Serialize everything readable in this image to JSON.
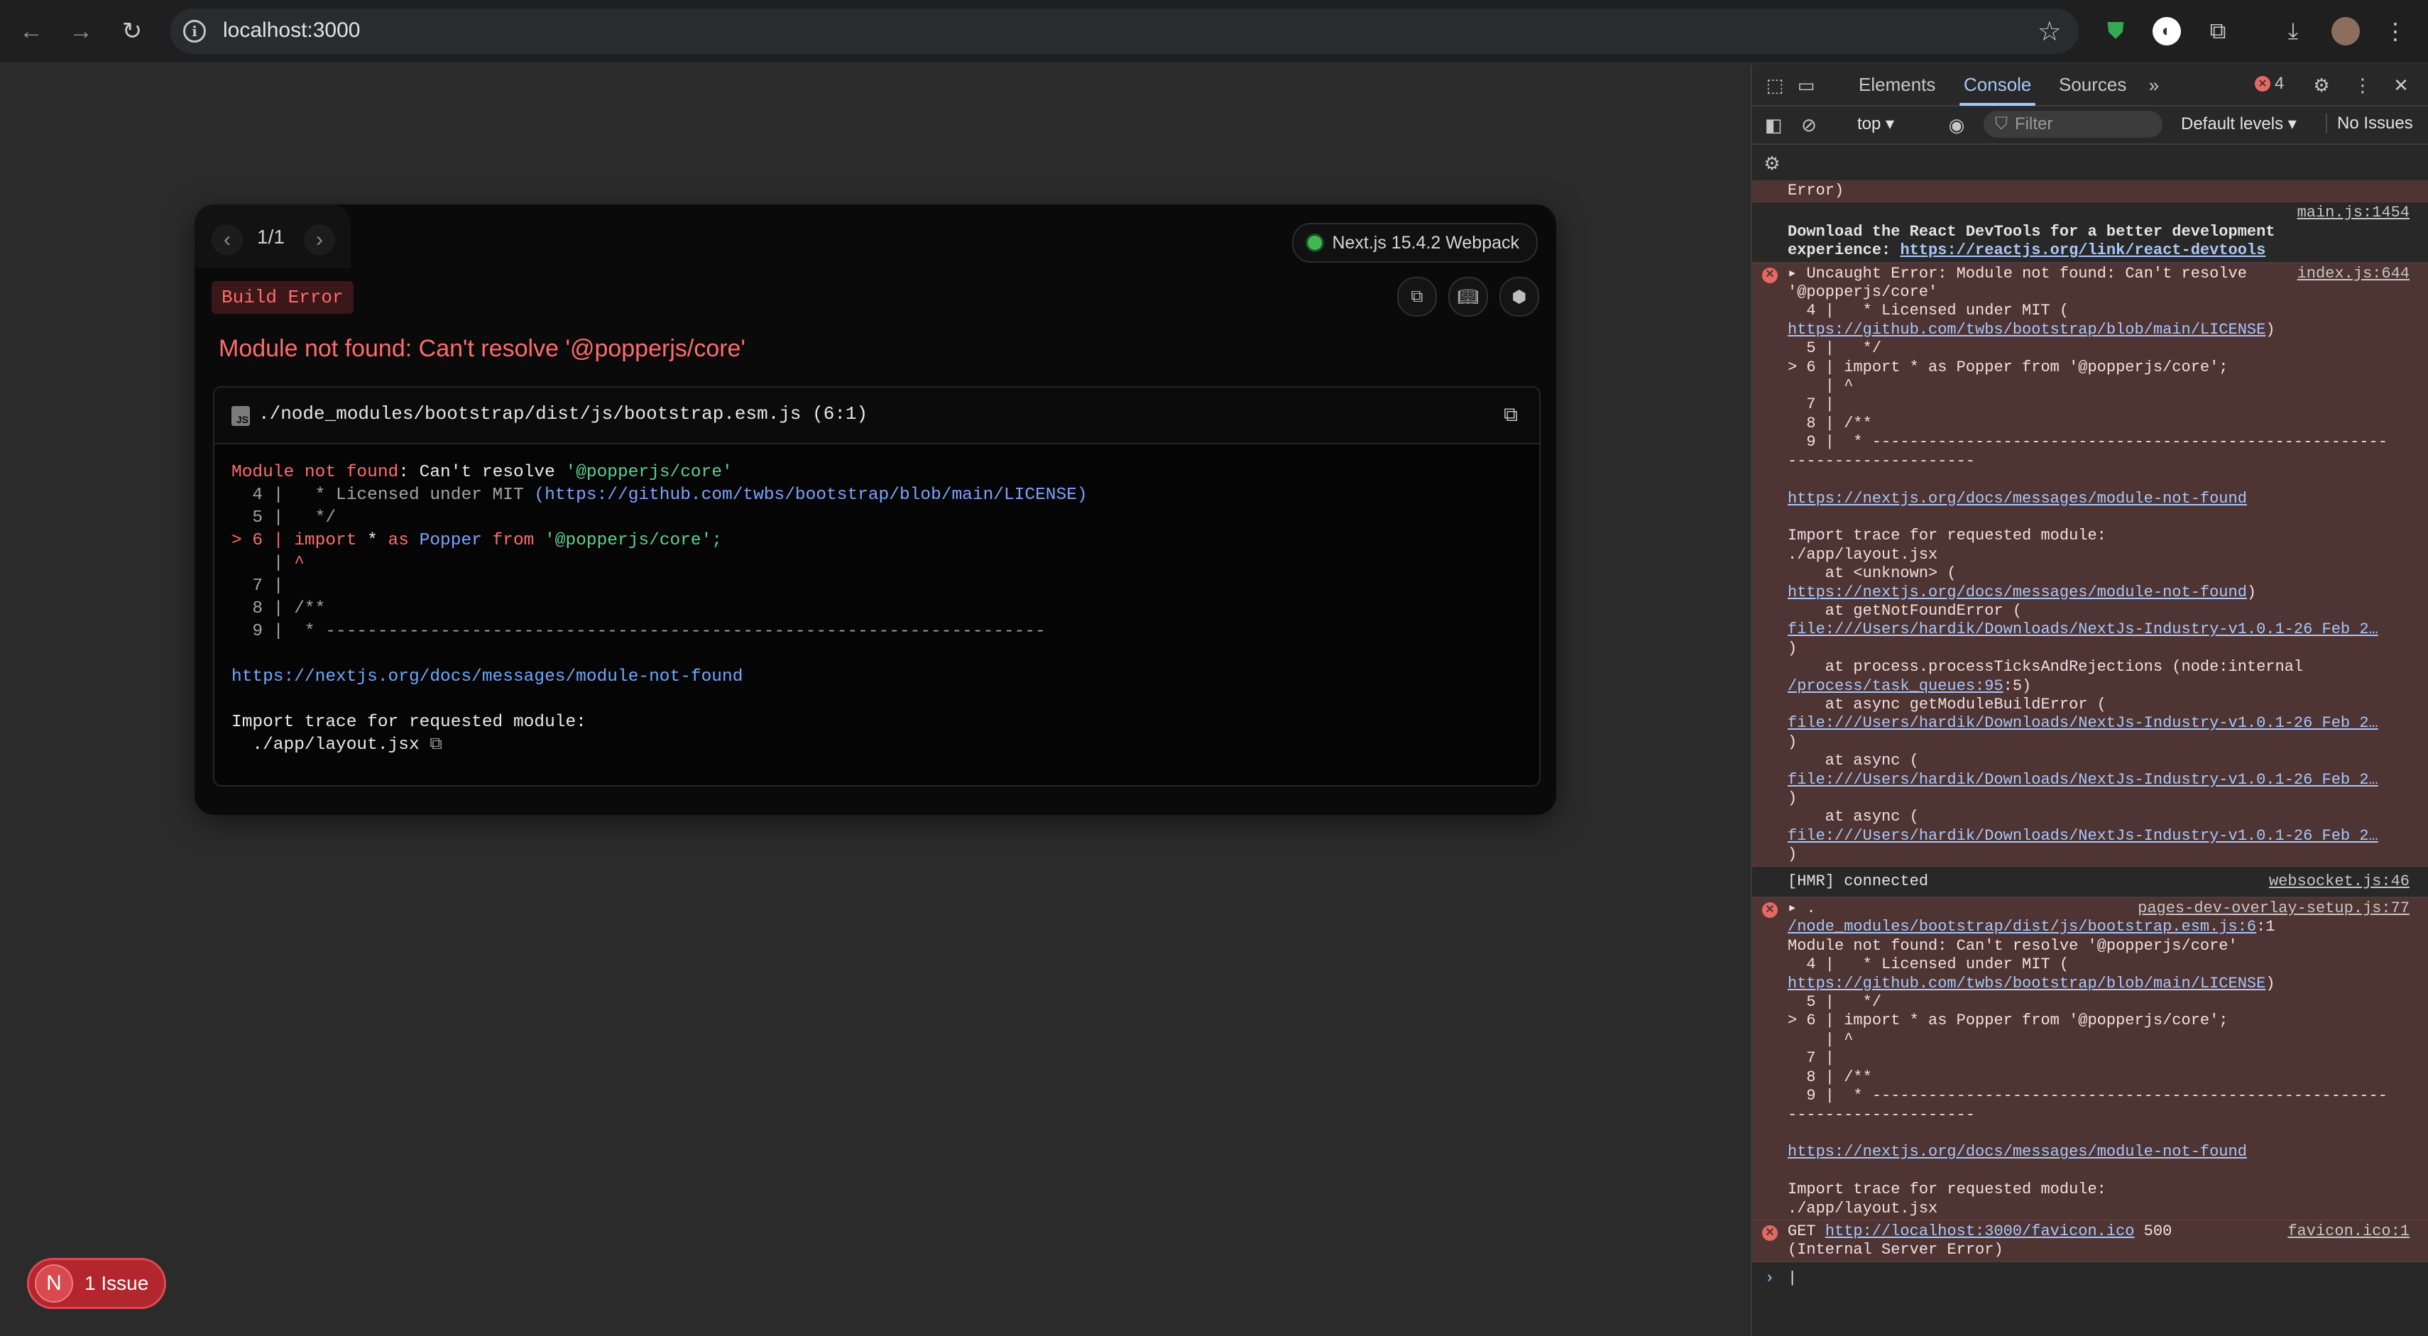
{
  "browser": {
    "url": "localhost:3000",
    "icons": [
      "back-icon",
      "forward-icon",
      "reload-icon",
      "info-icon",
      "star-icon",
      "shield-extension-icon",
      "extension-icon",
      "puzzle-icon",
      "download-icon",
      "profile-avatar"
    ]
  },
  "overlay": {
    "pager_count": "1/1",
    "version": "Next.js 15.4.2 Webpack",
    "badge": "Build Error",
    "title": "Module not found: Can't resolve '@popperjs/core'",
    "file_path": "./node_modules/bootstrap/dist/js/bootstrap.esm.js (6:1)",
    "file_icon_label": "JS",
    "code": {
      "l1_a": "Module not found",
      "l1_b": ": Can't resolve ",
      "l1_c": "'@popperjs/core'",
      "l2_a": "  4 |   * Licensed under MIT ",
      "l2_b": "(https://github.com/twbs/bootstrap/blob/main/LICENSE)",
      "l3": "  5 |   */",
      "l4_a": "> 6 | ",
      "l4_b": "import",
      "l4_c": " * ",
      "l4_d": "as",
      "l4_e": " Popper ",
      "l4_f": "from",
      "l4_g": " '@popperjs/core';",
      "l5_a": "    | ",
      "l5_b": "^",
      "l6": "  7 |",
      "l7": "  8 | /**",
      "l8": "  9 |  * ---------------------------------------------------------------------",
      "link": "https://nextjs.org/docs/messages/module-not-found",
      "trace_label": "Import trace for requested module:",
      "trace_file": "  ./app/layout.jsx"
    },
    "issue_button": {
      "letter": "N",
      "label": "1 Issue"
    }
  },
  "devtools": {
    "tabs": [
      "Elements",
      "Console",
      "Sources"
    ],
    "active_tab": "Console",
    "error_count": "4",
    "context": "top ▾",
    "filter_placeholder": "Filter",
    "levels": "Default levels ▾",
    "issues": "No Issues",
    "messages": {
      "m0": "Error)",
      "m1_src": "main.js:1454",
      "m1_l1": "Download the React DevTools for a better development",
      "m1_l2a": "experience: ",
      "m1_l2b": "https://reactjs.org/link/react-devtools",
      "m2_src": "index.js:644",
      "m2_l1": "▸ Uncaught Error: Module not found: Can't resolve",
      "m2_l2": "'@popperjs/core'",
      "m2_l3": "  4 |   * Licensed under MIT (",
      "m2_l4": "https://github.com/twbs/bootstrap/blob/main/LICENSE",
      "m2_l4b": ")",
      "m2_l5": "  5 |   */",
      "m2_l6": "> 6 | import * as Popper from '@popperjs/core';",
      "m2_l7": "    | ^",
      "m2_l8": "  7 |",
      "m2_l9": "  8 | /**",
      "m2_l10": "  9 |  * -------------------------------------------------------",
      "m2_l11": "--------------------",
      "m2_l12": "https://nextjs.org/docs/messages/module-not-found",
      "m2_l13": "Import trace for requested module:",
      "m2_l14": "./app/layout.jsx",
      "m2_l15": "    at <unknown> (",
      "m2_l16": "https://nextjs.org/docs/messages/module-not-found",
      "m2_l16b": ")",
      "m2_l17": "    at getNotFoundError (",
      "m2_l18": "file:///Users/hardik/Downloads/NextJs-Industry-v1.0.1-26 Feb 2…",
      "m2_l19": ")",
      "m2_l20": "    at process.processTicksAndRejections (node:internal",
      "m2_l21": "/process/task_queues:95",
      "m2_l21b": ":5)",
      "m2_l22": "    at async getModuleBuildError (",
      "m2_l23": "file:///Users/hardik/Downloads/NextJs-Industry-v1.0.1-26 Feb 2…",
      "m2_l24": ")",
      "m2_l25": "    at async (",
      "m2_l26": "file:///Users/hardik/Downloads/NextJs-Industry-v1.0.1-26 Feb 2…",
      "m2_l27": ")",
      "m2_l28": "    at async (",
      "m2_l29": "file:///Users/hardik/Downloads/NextJs-Industry-v1.0.1-26 Feb 2…",
      "m2_l30": ")",
      "m3": "[HMR] connected",
      "m3_src": "websocket.js:46",
      "m4_src": "pages-dev-overlay-setup.js:77",
      "m4_l1": "▸ .",
      "m4_l2": "/node_modules/bootstrap/dist/js/bootstrap.esm.js:6",
      "m4_l2b": ":1",
      "m4_l3": "Module not found: Can't resolve '@popperjs/core'",
      "m4_l4": "  4 |   * Licensed under MIT (",
      "m4_l5": "https://github.com/twbs/bootstrap/blob/main/LICENSE",
      "m4_l5b": ")",
      "m4_l6": "  5 |   */",
      "m4_l7": "> 6 | import * as Popper from '@popperjs/core';",
      "m4_l8": "    | ^",
      "m4_l9": "  7 |",
      "m4_l10": "  8 | /**",
      "m4_l11": "  9 |  * -------------------------------------------------------",
      "m4_l12": "--------------------",
      "m4_l13": "https://nextjs.org/docs/messages/module-not-found",
      "m4_l14": "Import trace for requested module:",
      "m4_l15": "./app/layout.jsx",
      "m5_a": "GET ",
      "m5_b": "http://localhost:3000/favicon.ico",
      "m5_c": " 500",
      "m5_l2": "(Internal Server Error)",
      "m5_src": "favicon.ico:1"
    },
    "prompt": "›"
  }
}
